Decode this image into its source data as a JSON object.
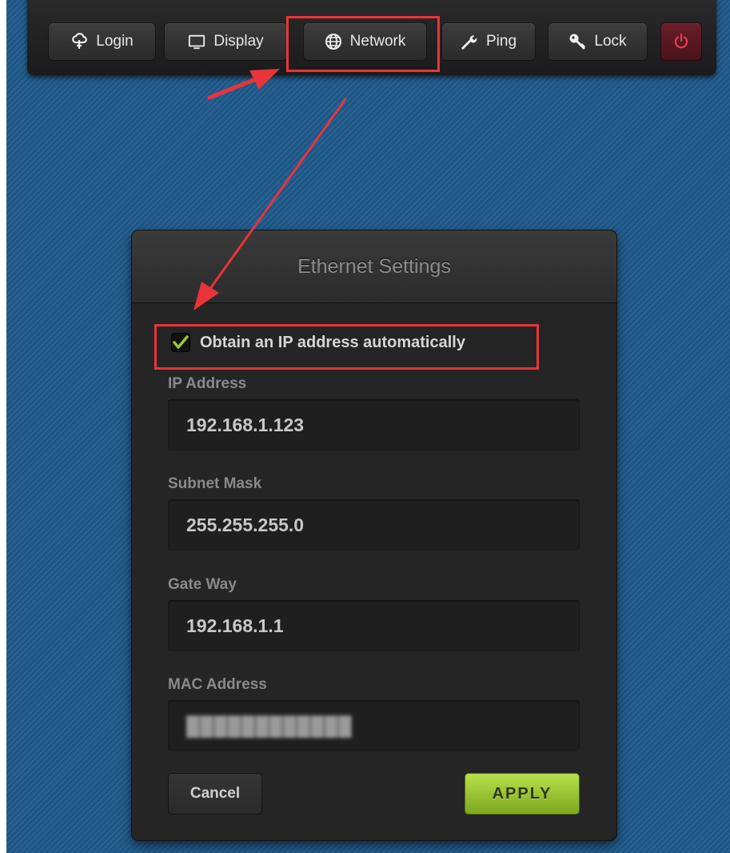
{
  "toolbar": {
    "buttons": [
      {
        "label": "Login",
        "icon": "cloud-upload-icon"
      },
      {
        "label": "Display",
        "icon": "monitor-icon"
      },
      {
        "label": "Network",
        "icon": "globe-icon"
      },
      {
        "label": "Ping",
        "icon": "wrench-icon"
      },
      {
        "label": "Lock",
        "icon": "key-icon"
      },
      {
        "label": "",
        "icon": "power-icon"
      }
    ]
  },
  "panel": {
    "title": "Ethernet Settings",
    "dhcp_checkbox": {
      "label": "Obtain an IP address automatically",
      "checked": true
    },
    "fields": [
      {
        "label": "IP Address",
        "value": "192.168.1.123"
      },
      {
        "label": "Subnet Mask",
        "value": "255.255.255.0"
      },
      {
        "label": "Gate Way",
        "value": "192.168.1.1"
      },
      {
        "label": "MAC Address",
        "value": "████████████"
      }
    ],
    "cancel_label": "Cancel",
    "apply_label": "APPLY"
  },
  "colors": {
    "background": "#1f5a8c",
    "annotation": "#e8343a",
    "apply": "#9cc830",
    "power": "#5a1820"
  }
}
